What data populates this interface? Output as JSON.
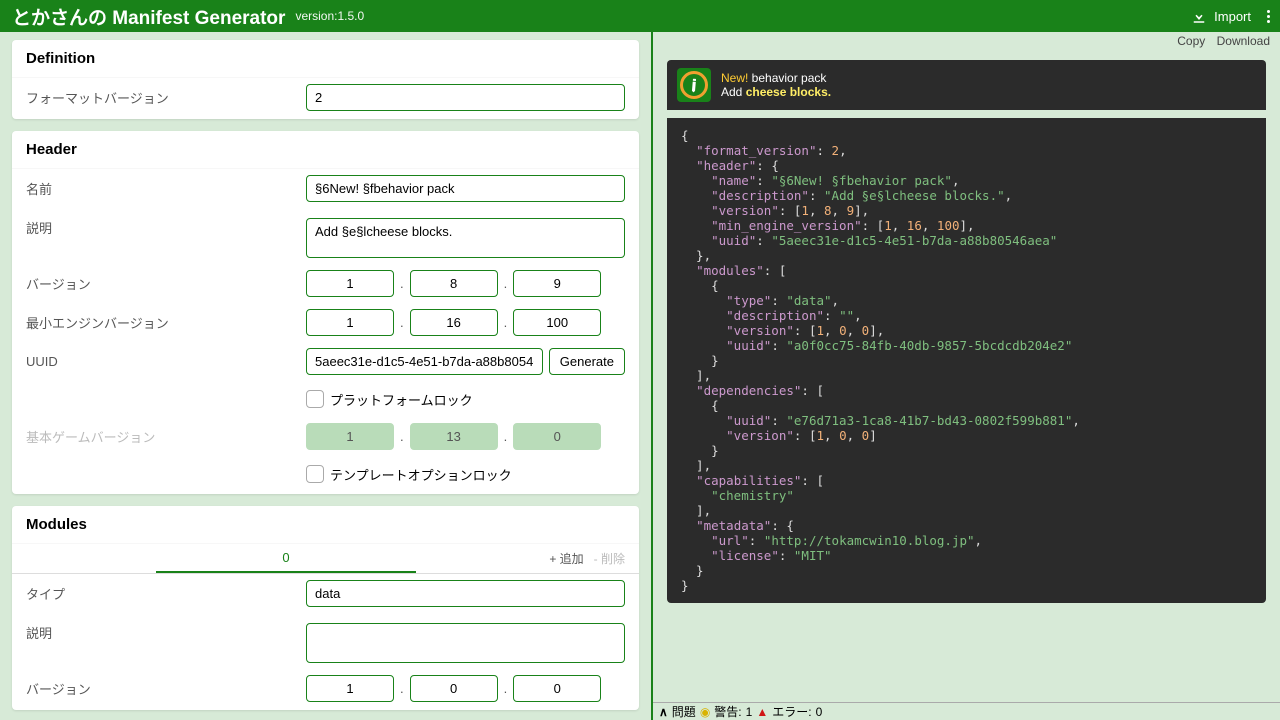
{
  "app": {
    "title": "とかさんの Manifest Generator",
    "version_label": "version:1.5.0",
    "import": "Import"
  },
  "toolbar": {
    "copy": "Copy",
    "download": "Download"
  },
  "sections": {
    "definition": "Definition",
    "header": "Header",
    "modules": "Modules"
  },
  "labels": {
    "format_version": "フォーマットバージョン",
    "name": "名前",
    "description": "説明",
    "version": "バージョン",
    "min_engine": "最小エンジンバージョン",
    "uuid": "UUID",
    "generate": "Generate",
    "platform_lock": "プラットフォームロック",
    "base_game_version": "基本ゲームバージョン",
    "template_lock": "テンプレートオプションロック",
    "type": "タイプ",
    "module_desc": "説明",
    "module_version": "バージョン",
    "add": "+ 追加",
    "del": "- 削除"
  },
  "values": {
    "format_version": "2",
    "name": "§6New! §fbehavior pack",
    "description": "Add §e§lcheese blocks.",
    "version": [
      "1",
      "8",
      "9"
    ],
    "min_engine": [
      "1",
      "16",
      "100"
    ],
    "uuid": "5aeec31e-d1c5-4e51-b7da-a88b80546ae",
    "base_game": [
      "1",
      "13",
      "0"
    ]
  },
  "modules": {
    "tab": "0",
    "type": "data",
    "description": "",
    "version": [
      "1",
      "0",
      "0"
    ]
  },
  "preview_header": {
    "new": "New!",
    "title_rest": " behavior pack",
    "desc_pre": "Add ",
    "desc_hi": "cheese blocks."
  },
  "status": {
    "problems": "問題",
    "warn_label": "警告:",
    "warn_count": "1",
    "err_label": "エラー:",
    "err_count": "0"
  }
}
